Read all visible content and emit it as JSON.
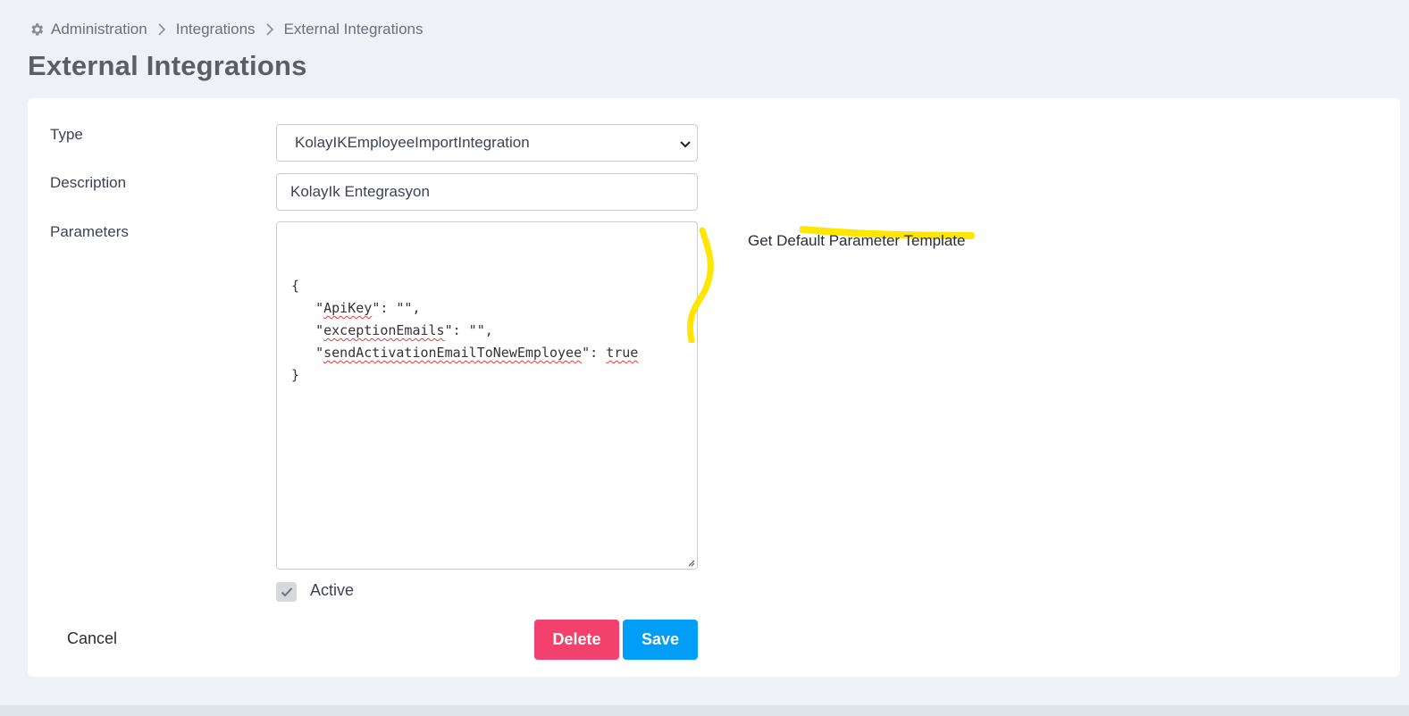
{
  "breadcrumb": {
    "items": [
      "Administration",
      "Integrations",
      "External Integrations"
    ],
    "icon": "gear-icon",
    "separator_icon": "chevron-right-icon"
  },
  "page": {
    "title": "External Integrations"
  },
  "form": {
    "type_label": "Type",
    "type_value": "KolayIKEmployeeImportIntegration",
    "description_label": "Description",
    "description_value": "KolayIk Entegrasyon",
    "parameters_label": "Parameters",
    "parameters_lines": [
      [
        "{"
      ],
      [
        "   \"",
        {
          "sq": "ApiKey"
        },
        "\": \"\","
      ],
      [
        "   \"",
        {
          "sq": "exceptionEmails"
        },
        "\": \"\","
      ],
      [
        "   \"",
        {
          "sq": "sendActivationEmailToNewEmployee"
        },
        "\": ",
        {
          "sq": "true"
        }
      ],
      [
        "}"
      ]
    ],
    "default_template_link": "Get Default Parameter Template",
    "active_label": "Active",
    "active_checked": true
  },
  "actions": {
    "cancel_label": "Cancel",
    "delete_label": "Delete",
    "save_label": "Save"
  },
  "colors": {
    "delete": "#f1416c",
    "save": "#009ef7",
    "highlight": "#ffe600",
    "background": "#eef1f5"
  }
}
